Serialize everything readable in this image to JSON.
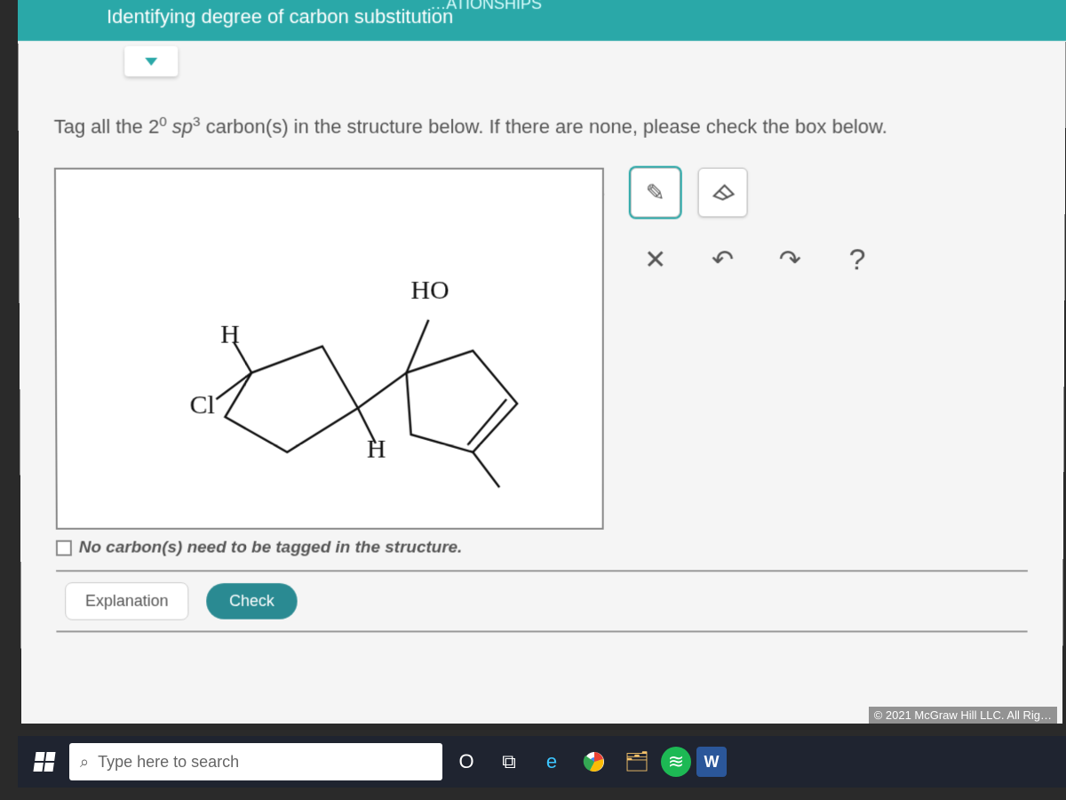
{
  "header": {
    "partial_top": "…ATIONSHIPS",
    "title": "Identifying degree of carbon substitution"
  },
  "prompt": {
    "prefix": "Tag all the ",
    "degree_base": "2",
    "degree_sup": "0",
    "hybrid_base": "sp",
    "hybrid_sup": "3",
    "suffix": " carbon(s) in the structure below. If there are none, please check the box below."
  },
  "molecule_labels": {
    "ho": "HO",
    "h_top": "H",
    "cl": "Cl",
    "h_bottom": "H"
  },
  "tools": {
    "pen": "✎",
    "eraser": "eraser",
    "clear": "✕",
    "undo": "↶",
    "redo": "↷",
    "help": "?"
  },
  "checkbox_label": "No carbon(s) need to be tagged in the structure.",
  "buttons": {
    "explanation": "Explanation",
    "check": "Check"
  },
  "copyright": "© 2021 McGraw Hill LLC. All Rig…",
  "taskbar": {
    "search_placeholder": "Type here to search",
    "icons": {
      "cortana": "O",
      "taskview": "⧉",
      "edge": "e",
      "chrome": "◎",
      "explorer": "🗂",
      "spotify": "≋",
      "word": "W"
    }
  }
}
